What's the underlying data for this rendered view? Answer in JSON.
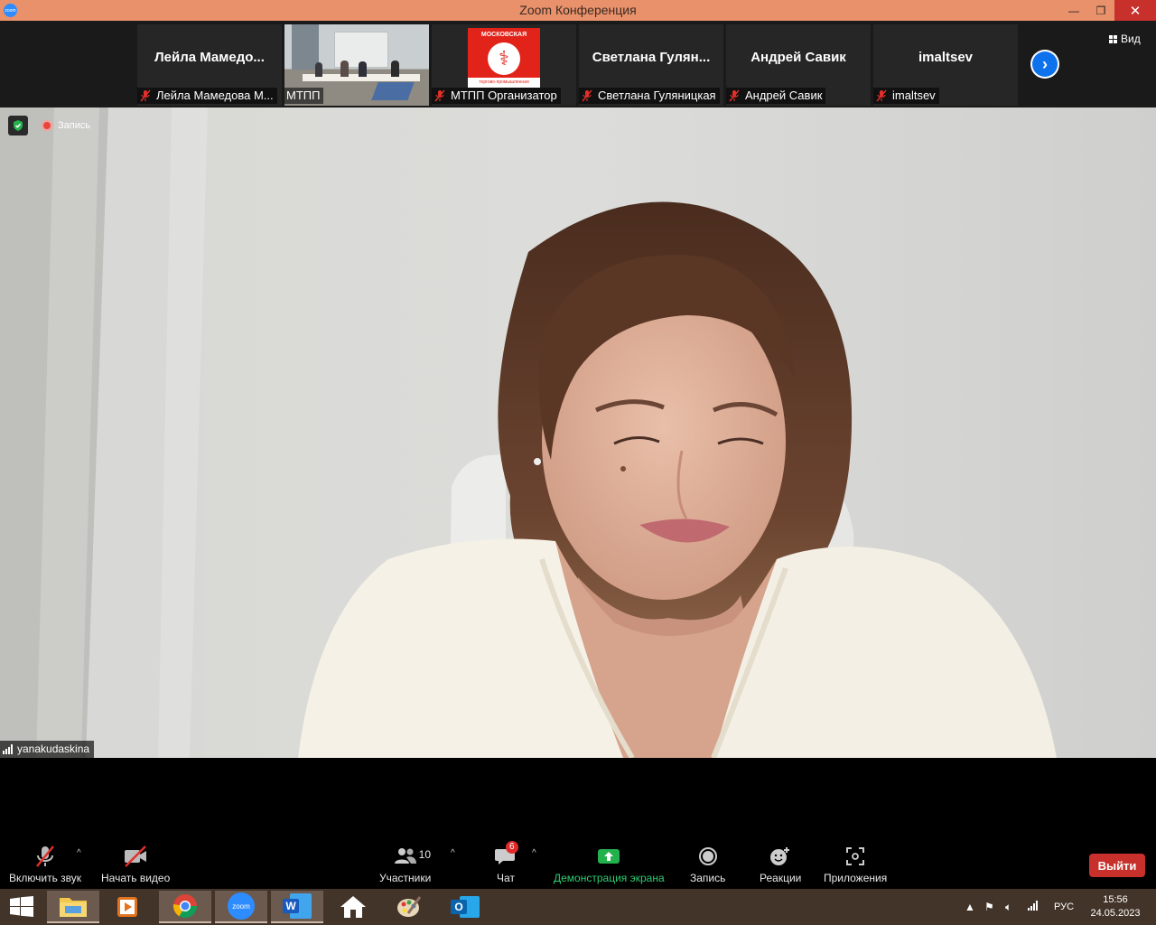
{
  "window": {
    "title": "Zoom Конференция",
    "app_icon_text": "zoom",
    "minimize": "—",
    "restore": "❐",
    "close": "✕"
  },
  "gallery": {
    "view_label": "Вид",
    "tiles": [
      {
        "display_name": "Лейла  Мамедо...",
        "label": "Лейла Мамедова М...",
        "muted": true,
        "has_video": false
      },
      {
        "display_name": "",
        "label": "МТПП",
        "muted": false,
        "has_video": true
      },
      {
        "display_name": "",
        "label": "МТПП Организатор",
        "muted": true,
        "has_video": false,
        "logo_text_top": "МОСКОВСКАЯ",
        "logo_text_bottom": "торгово-промышленная"
      },
      {
        "display_name": "Светлана  Гулян...",
        "label": "Светлана Гуляницкая",
        "muted": true,
        "has_video": false
      },
      {
        "display_name": "Андрей Савик",
        "label": "Андрей Савик",
        "muted": true,
        "has_video": false
      },
      {
        "display_name": "imaltsev",
        "label": "imaltsev",
        "muted": true,
        "has_video": false
      }
    ]
  },
  "main_video": {
    "recording_label": "Запись",
    "speaker_name": "yanakudaskina"
  },
  "toolbar": {
    "audio_label": "Включить звук",
    "video_label": "Начать видео",
    "participants_label": "Участники",
    "participants_count": "10",
    "chat_label": "Чат",
    "chat_badge": "6",
    "share_label": "Демонстрация экрана",
    "record_label": "Запись",
    "reactions_label": "Реакции",
    "apps_label": "Приложения",
    "exit_label": "Выйти",
    "colors": {
      "share": "#2ecc71",
      "exit": "#c7302b",
      "accent": "#0e72ed"
    }
  },
  "taskbar": {
    "apps": [
      "start-icon",
      "file-explorer-icon",
      "media-player-icon",
      "chrome-icon",
      "zoom-icon",
      "word-icon",
      "home-icon",
      "paint-icon",
      "outlook-icon"
    ],
    "zoom_text": "zoom",
    "word_letter": "W",
    "outlook_letter": "O",
    "language": "РУС",
    "time": "15:56",
    "date": "24.05.2023"
  }
}
